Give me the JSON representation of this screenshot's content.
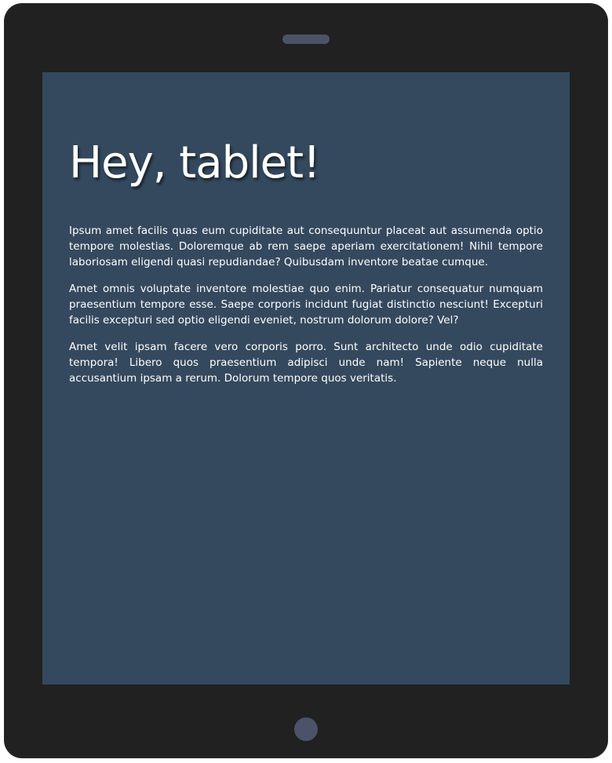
{
  "page": {
    "title": "Hey, tablet!",
    "paragraphs": [
      "Ipsum amet facilis quas eum cupiditate aut consequuntur placeat aut assumenda optio tempore molestias. Doloremque ab rem saepe aperiam exercitationem! Nihil tempore laboriosam eligendi quasi repudiandae? Quibusdam inventore beatae cumque.",
      "Amet omnis voluptate inventore molestiae quo enim. Pariatur consequatur numquam praesentium tempore esse. Saepe corporis incidunt fugiat distinctio nesciunt! Excepturi facilis excepturi sed optio eligendi eveniet, nostrum dolorum dolore? Vel?",
      "Amet velit ipsam facere vero corporis porro. Sunt architecto unde odio cupiditate tempora! Libero quos praesentium adipisci unde nam! Sapiente neque nulla accusantium ipsam a rerum. Dolorum tempore quos veritatis."
    ]
  },
  "colors": {
    "device_frame": "#212121",
    "screen_background": "#34495e",
    "hardware_accent": "#4b5368",
    "text": "#ffffff"
  }
}
